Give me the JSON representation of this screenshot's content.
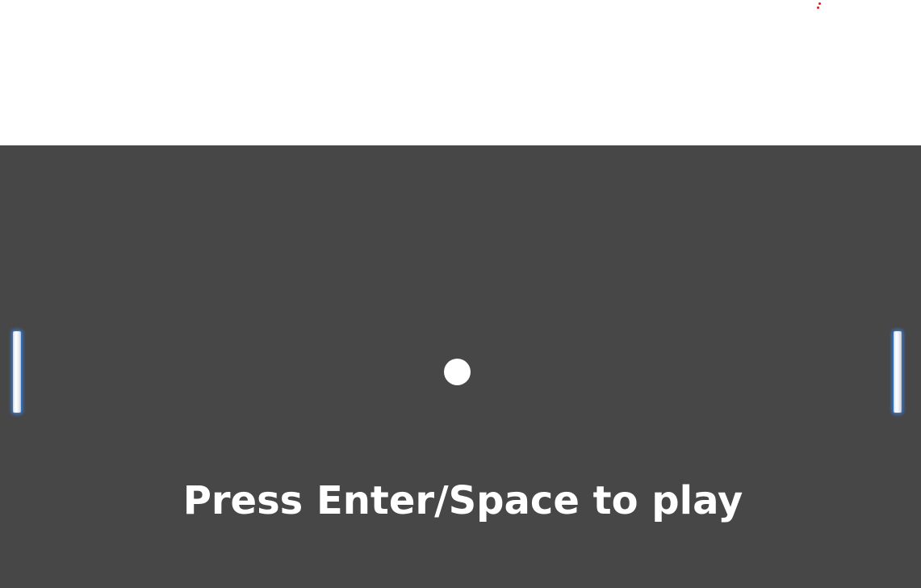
{
  "game": {
    "prompt_text": "Press Enter/Space to play"
  },
  "colors": {
    "background_top": "#ffffff",
    "canvas": "#474747",
    "ball": "#ffffff",
    "paddle_glow": "#3c78c8",
    "indicator": "#d21f1f"
  },
  "icons": {
    "indicator": "vertical-dots-icon"
  }
}
